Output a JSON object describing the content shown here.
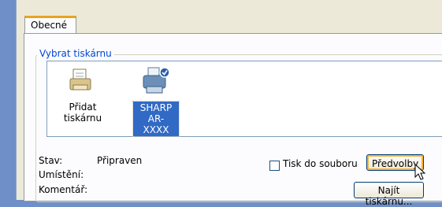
{
  "tabs": [
    {
      "label": "Obecné"
    }
  ],
  "group": {
    "title": "Vybrat tiskárnu"
  },
  "printers": [
    {
      "label": "Přidat tiskárnu",
      "icon": "add-printer-icon",
      "selected": false
    },
    {
      "label_lines": [
        "SHARP",
        "AR-XXXX"
      ],
      "icon": "printer-icon",
      "selected": true
    }
  ],
  "status": {
    "state_label": "Stav:",
    "state_value": "Připraven",
    "location_label": "Umístění:",
    "comment_label": "Komentář:"
  },
  "print_to_file": {
    "label": "Tisk do souboru",
    "checked": false
  },
  "buttons": {
    "preferences": "Předvolby",
    "find_printer": "Najít tiskárnu..."
  },
  "colors": {
    "accent_tab": "#e8a323",
    "selection": "#316ac5",
    "group_title": "#0046d5"
  }
}
